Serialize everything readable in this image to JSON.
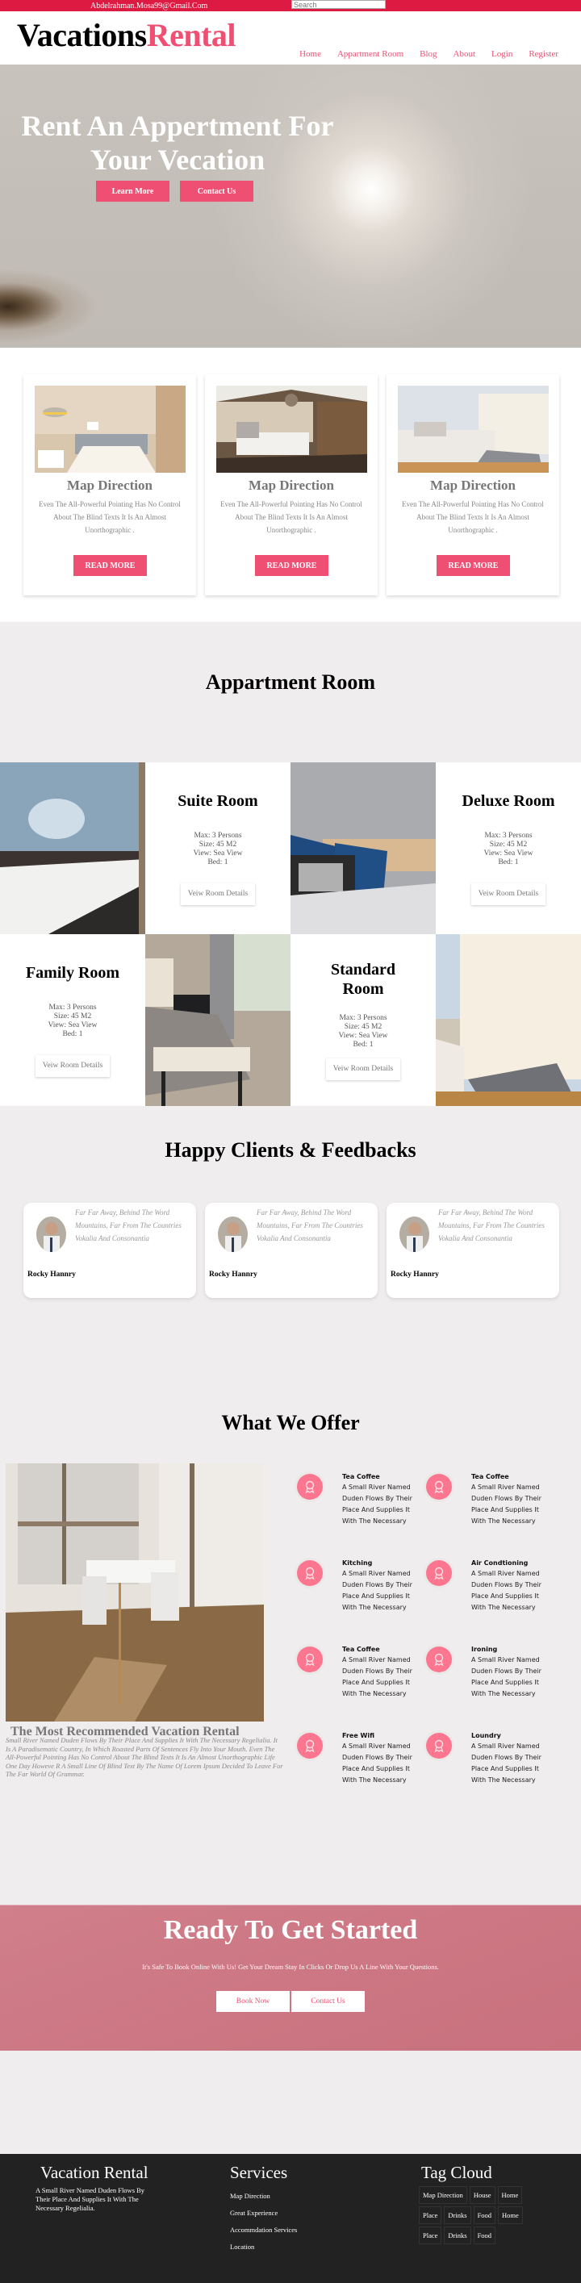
{
  "topbar": {
    "email": "Abdelrahman.Mosa99@Gmail.Com",
    "search_placeholder": "Search"
  },
  "header": {
    "logo_part1": "Vacations",
    "logo_part2": "Rental",
    "nav": [
      "Home",
      "Appartment Room",
      "Blog",
      "About",
      "Login",
      "Register"
    ]
  },
  "hero": {
    "title": "Rent An Appertment For Your Vecation",
    "learn_more": "Learn More",
    "contact_us": "Contact Us"
  },
  "services": [
    {
      "title": "Map Direction",
      "text": "Even The All-Powerful Pointing Has No Control About The Blind Texts It Is An Almost Unorthographic .",
      "button": "READ MORE"
    },
    {
      "title": "Map Direction",
      "text": "Even The All-Powerful Pointing Has No Control About The Blind Texts It Is An Almost Unorthographic .",
      "button": "READ MORE"
    },
    {
      "title": "Map Direction",
      "text": "Even The All-Powerful Pointing Has No Control About The Blind Texts It Is An Almost Unorthographic .",
      "button": "READ MORE"
    }
  ],
  "appartment": {
    "title": "Appartment Room",
    "rooms": [
      {
        "name": "Suite Room",
        "max": "Max: 3 Persons",
        "size": "Size: 45 M2",
        "view": "View: Sea View",
        "bed": "Bed: 1",
        "button": "Veiw Room Details"
      },
      {
        "name": "Deluxe Room",
        "max": "Max: 3 Persons",
        "size": "Size: 45 M2",
        "view": "View: Sea View",
        "bed": "Bed: 1",
        "button": "Veiw Room Details"
      },
      {
        "name": "Family Room",
        "max": "Max: 3 Persons",
        "size": "Size: 45 M2",
        "view": "View: Sea View",
        "bed": "Bed: 1",
        "button": "Veiw Room Details"
      },
      {
        "name": "Standard Room",
        "max": "Max: 3 Persons",
        "size": "Size: 45 M2",
        "view": "View: Sea View",
        "bed": "Bed: 1",
        "button": "Veiw Room Details"
      }
    ]
  },
  "clients": {
    "title": "Happy Clients & Feedbacks",
    "items": [
      {
        "quote": "Far Far Away, Behind The Word Mountains, Far From The Countries Vokalia And Consonantia",
        "name": "Rocky Hannry"
      },
      {
        "quote": "Far Far Away, Behind The Word Mountains, Far From The Countries Vokalia And Consonantia",
        "name": "Rocky Hannry"
      },
      {
        "quote": "Far Far Away, Behind The Word Mountains, Far From The Countries Vokalia And Consonantia",
        "name": "Rocky Hannry"
      }
    ]
  },
  "offer": {
    "title": "What We Offer",
    "heading": "The Most Recommended Vacation Rental",
    "description": "Small River Named Duden Flows By Their Place And Supplies It With The Necessary Regelialia. It Is A Paradisematic Country, In Which Roasted Parts Of Sentences Fly Into Your Mouth. Even The All-Powerful Pointing Has No Control About The Blind Texts It Is An Almost Unorthographic Life One Day Howeve R A Small Line Of Blind Text By The Name Of Lorem Ipsum Decided To Leave For The Far World Of Grammar.",
    "features": [
      {
        "title": "Tea Coffee",
        "text": "A Small River Named Duden Flows By Their Place And Supplies It With The Necessary",
        "icon": "award-icon"
      },
      {
        "title": "Tea Coffee",
        "text": "A Small River Named Duden Flows By Their Place And Supplies It With The Necessary",
        "icon": "award-icon"
      },
      {
        "title": "Kitching",
        "text": "A Small River Named Duden Flows By Their Place And Supplies It With The Necessary",
        "icon": "award-icon"
      },
      {
        "title": "Air Condtioning",
        "text": "A Small River Named Duden Flows By Their Place And Supplies It With The Necessary",
        "icon": "award-icon"
      },
      {
        "title": "Tea Coffee",
        "text": "A Small River Named Duden Flows By Their Place And Supplies It With The Necessary",
        "icon": "award-icon"
      },
      {
        "title": "Ironing",
        "text": "A Small River Named Duden Flows By Their Place And Supplies It With The Necessary",
        "icon": "award-icon"
      },
      {
        "title": "Free Wifi",
        "text": "A Small River Named Duden Flows By Their Place And Supplies It With The Necessary",
        "icon": "award-icon"
      },
      {
        "title": "Loundry",
        "text": "A Small River Named Duden Flows By Their Place And Supplies It With The Necessary",
        "icon": "award-icon"
      }
    ]
  },
  "cta": {
    "title": "Ready To Get Started",
    "subtitle": "It's Safe To Book Online With Us! Get Your Dream Stay In Clicks Or Drop Us A Line With Your Questions.",
    "book_now": "Book Now",
    "contact_us": "Contact Us"
  },
  "footer": {
    "about_title": "Vacation Rental",
    "about_text": "A Small River Named Duden Flows By Their Place And Supplies It With The Necessary Regelialia.",
    "services_title": "Services",
    "services": [
      "Map Direction",
      "Great Experience",
      "Accommdation Services",
      "Location"
    ],
    "tags_title": "Tag Cloud",
    "tags": [
      "Map Direction",
      "House",
      "Home",
      "Place",
      "Drinks",
      "Food",
      "Home",
      "Place",
      "Drinks",
      "Food"
    ]
  },
  "colors": {
    "brand_pink": "#ef4f73",
    "topbar_red": "#dc1a42",
    "feature_icon": "#fd7690",
    "footer_bg": "#222222"
  }
}
